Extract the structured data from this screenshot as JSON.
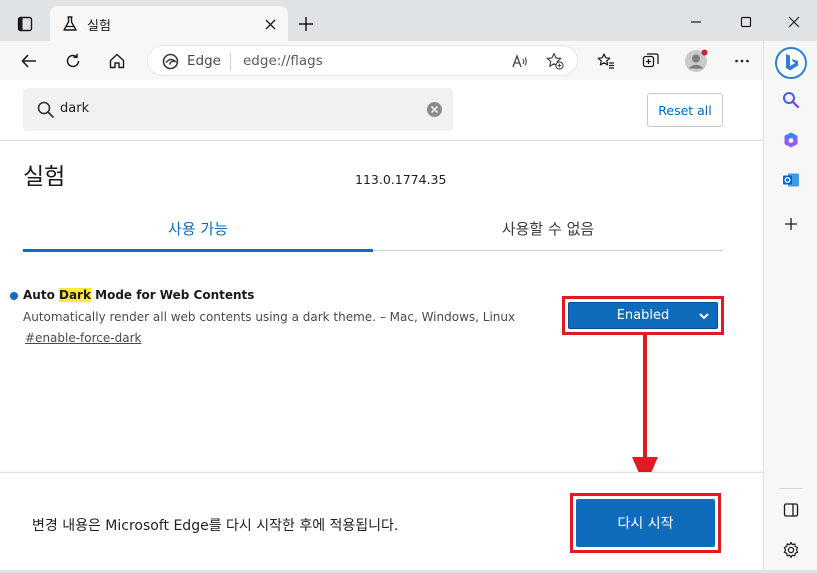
{
  "tab": {
    "title": "실험",
    "icon": "flask-icon"
  },
  "toolbar": {
    "address_site": "Edge",
    "address_url": "edge://flags"
  },
  "search": {
    "value": "dark",
    "placeholder": "Search flags"
  },
  "reset_all_label": "Reset all",
  "page": {
    "title": "실험",
    "version": "113.0.1774.35"
  },
  "tabs": {
    "available": "사용 가능",
    "unavailable": "사용할 수 없음"
  },
  "flag": {
    "title_before": "Auto ",
    "title_highlight": "Dark",
    "title_after": " Mode for Web Contents",
    "description": "Automatically render all web contents using a dark theme. – Mac, Windows, Linux",
    "link": "#enable-force-dark",
    "selected_value": "Enabled"
  },
  "footer": {
    "message": "변경 내용은 Microsoft Edge를 다시 시작한 후에 적용됩니다.",
    "restart_label": "다시 시작"
  },
  "colors": {
    "accent": "#0f6cbd",
    "highlight": "#ffe83a",
    "annotation_red": "#e01b24"
  }
}
